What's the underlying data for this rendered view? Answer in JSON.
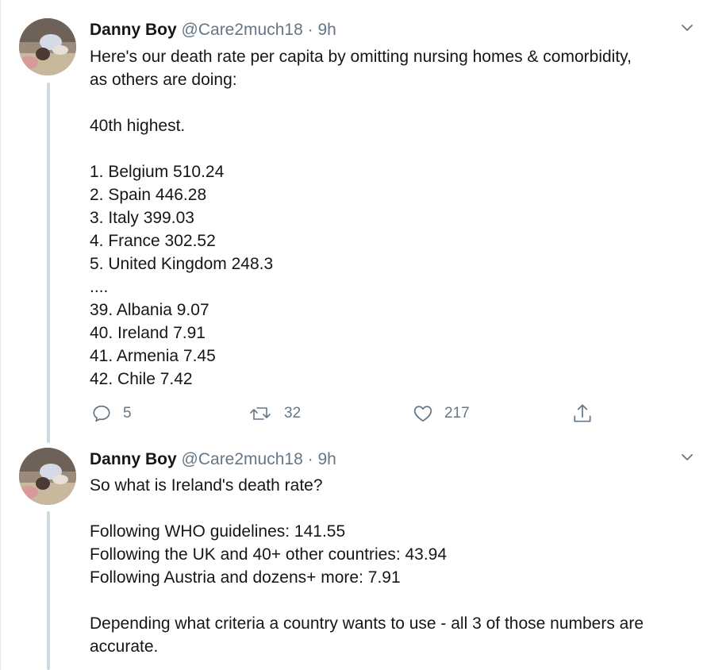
{
  "tweets": [
    {
      "display_name": "Danny Boy",
      "handle": "@Care2much18",
      "separator": "·",
      "time": "9h",
      "lines": [
        "Here's our death rate per capita by omitting nursing homes & comorbidity,",
        "as others are doing:",
        "",
        "40th highest.",
        "",
        "1. Belgium 510.24",
        "2. Spain 446.28",
        "3. Italy 399.03",
        "4. France 302.52",
        "5. United Kingdom 248.3",
        "....",
        "39. Albania 9.07",
        "40. Ireland 7.91",
        "41. Armenia 7.45",
        "42. Chile 7.42"
      ],
      "actions": {
        "reply_count": "5",
        "retweet_count": "32",
        "like_count": "217"
      }
    },
    {
      "display_name": "Danny Boy",
      "handle": "@Care2much18",
      "separator": "·",
      "time": "9h",
      "lines": [
        "So what is Ireland's death rate?",
        "",
        "Following WHO guidelines: 141.55",
        "Following the UK and 40+ other countries: 43.94",
        "Following Austria and dozens+ more: 7.91",
        "",
        "Depending what criteria a country wants to use - all 3 of those numbers are",
        "accurate."
      ]
    }
  ],
  "icons": {
    "reply": "reply-icon",
    "retweet": "retweet-icon",
    "like": "heart-icon",
    "share": "share-icon",
    "menu": "chevron-down-icon"
  },
  "colors": {
    "text": "#14171a",
    "muted": "#657786",
    "thread_line": "#cfd9de",
    "divider": "#e6ecf0"
  }
}
